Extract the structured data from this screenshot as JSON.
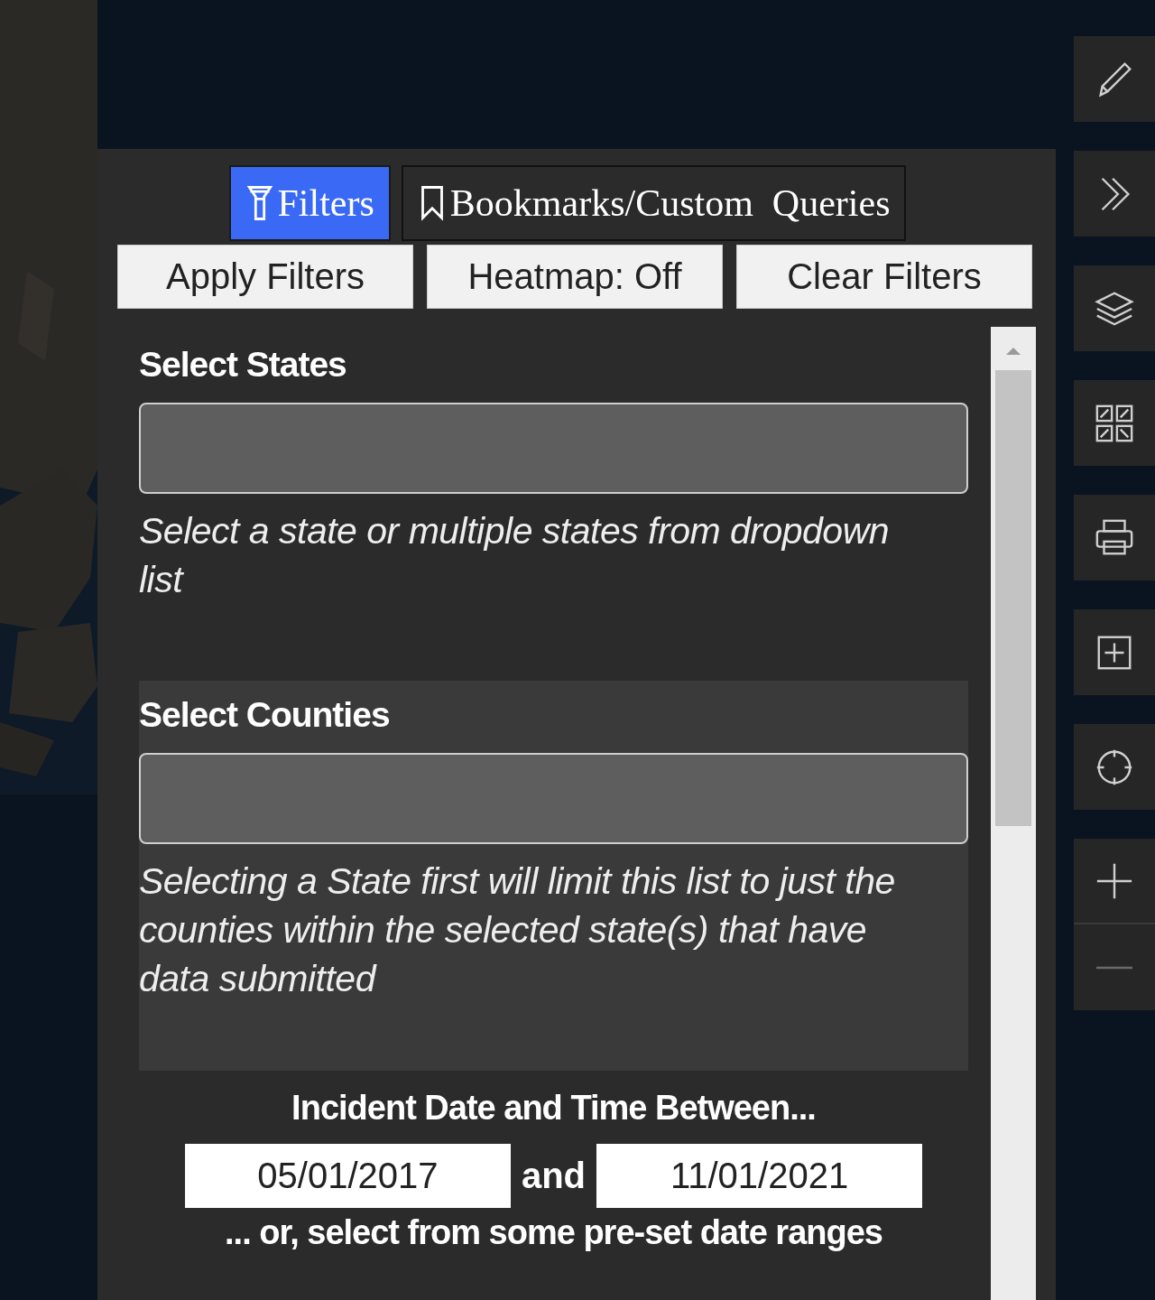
{
  "tabs": [
    {
      "label": "Filters",
      "selected": true
    },
    {
      "label": "Bookmarks/Custom  Queries",
      "selected": false
    }
  ],
  "actions": [
    "Apply Filters",
    "Heatmap: Off",
    "Clear Filters"
  ],
  "sections": [
    {
      "heading": "Select States",
      "help": "Select a state or multiple states from dropdown list",
      "shaded": false
    },
    {
      "heading": "Select Counties",
      "help": "Selecting a State first will limit this list to just the counties within the selected state(s) that have data submitted",
      "shaded": true
    }
  ],
  "date_range": {
    "heading": "Incident Date and Time Between...",
    "start": "05/01/2017",
    "joiner": "and",
    "end": "11/01/2021",
    "note": "... or, select from some pre-set date ranges"
  },
  "toolbar": [
    {
      "kind": "edit"
    },
    {
      "kind": "expand"
    },
    {
      "kind": "layers"
    },
    {
      "kind": "grid"
    },
    {
      "kind": "print"
    },
    {
      "kind": "add-box"
    },
    {
      "kind": "locate"
    },
    {
      "kind": "zoom-in"
    },
    {
      "kind": "zoom-out"
    }
  ]
}
